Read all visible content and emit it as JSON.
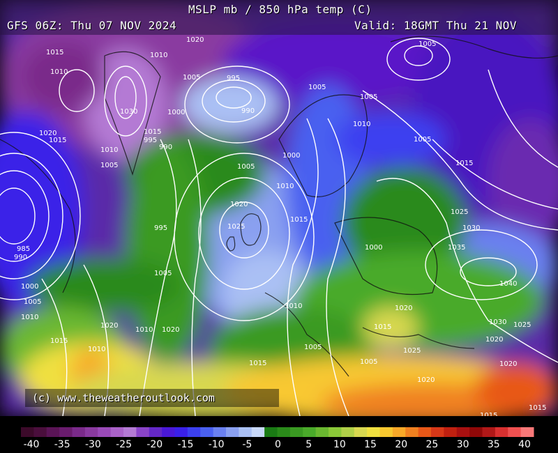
{
  "header": {
    "title": "MSLP mb / 850 hPa temp (C)",
    "run": "GFS 06Z: Thu 07 NOV 2024",
    "valid": "Valid: 18GMT Thu 21 NOV"
  },
  "credit": "(c) www.theweatheroutlook.com",
  "isobar_labels": [
    "1020",
    "1015",
    "1010",
    "1005",
    "1000",
    "995",
    "990",
    "985",
    "1025",
    "1030",
    "1035",
    "1040"
  ],
  "map_labels": [
    {
      "id": "l1",
      "text": "1015"
    },
    {
      "id": "l2",
      "text": "1010"
    },
    {
      "id": "l3",
      "text": "1010"
    },
    {
      "id": "l4",
      "text": "1005"
    },
    {
      "id": "l5",
      "text": "995"
    },
    {
      "id": "l6",
      "text": "990"
    },
    {
      "id": "l7",
      "text": "1030"
    },
    {
      "id": "l8",
      "text": "1000"
    },
    {
      "id": "l9",
      "text": "1015"
    },
    {
      "id": "l10",
      "text": "995"
    },
    {
      "id": "l11",
      "text": "990"
    },
    {
      "id": "l12",
      "text": "1005"
    },
    {
      "id": "l13",
      "text": "1005"
    },
    {
      "id": "l14",
      "text": "1000"
    },
    {
      "id": "l15",
      "text": "1005"
    },
    {
      "id": "l16",
      "text": "1010"
    },
    {
      "id": "l17",
      "text": "1020"
    },
    {
      "id": "l18",
      "text": "1025"
    },
    {
      "id": "l19",
      "text": "1015"
    },
    {
      "id": "l20",
      "text": "995"
    },
    {
      "id": "l21",
      "text": "1005"
    },
    {
      "id": "l22",
      "text": "1020"
    },
    {
      "id": "l23",
      "text": "1015"
    },
    {
      "id": "l24",
      "text": "985"
    },
    {
      "id": "l25",
      "text": "990"
    },
    {
      "id": "l26",
      "text": "1000"
    },
    {
      "id": "l27",
      "text": "1005"
    },
    {
      "id": "l28",
      "text": "1010"
    },
    {
      "id": "l29",
      "text": "1020"
    },
    {
      "id": "l30",
      "text": "1015"
    },
    {
      "id": "l31",
      "text": "1010"
    },
    {
      "id": "l32",
      "text": "1010"
    },
    {
      "id": "l33",
      "text": "1005"
    },
    {
      "id": "l34",
      "text": "1020"
    },
    {
      "id": "l35",
      "text": "1010"
    },
    {
      "id": "l36",
      "text": "1005"
    },
    {
      "id": "l37",
      "text": "1000"
    },
    {
      "id": "l38",
      "text": "1015"
    },
    {
      "id": "l39",
      "text": "1005"
    },
    {
      "id": "l40",
      "text": "1010"
    },
    {
      "id": "l41",
      "text": "1015"
    },
    {
      "id": "l42",
      "text": "1025"
    },
    {
      "id": "l43",
      "text": "1030"
    },
    {
      "id": "l44",
      "text": "1035"
    },
    {
      "id": "l45",
      "text": "1040"
    },
    {
      "id": "l46",
      "text": "1030"
    },
    {
      "id": "l47",
      "text": "1025"
    },
    {
      "id": "l48",
      "text": "1020"
    },
    {
      "id": "l49",
      "text": "1015"
    },
    {
      "id": "l50",
      "text": "1020"
    },
    {
      "id": "l51",
      "text": "1025"
    },
    {
      "id": "l52",
      "text": "1020"
    },
    {
      "id": "l53",
      "text": "1020"
    },
    {
      "id": "l54",
      "text": "1005"
    },
    {
      "id": "l55",
      "text": "1015"
    },
    {
      "id": "l56",
      "text": "1020"
    },
    {
      "id": "l57",
      "text": "1015"
    },
    {
      "id": "l58",
      "text": "1010"
    },
    {
      "id": "l59",
      "text": "1005"
    },
    {
      "id": "l60",
      "text": "1020"
    }
  ],
  "color_scale": {
    "ticks": [
      "-40",
      "-35",
      "-30",
      "-25",
      "-20",
      "-15",
      "-10",
      "-5",
      "0",
      "5",
      "10",
      "15",
      "20",
      "25",
      "30",
      "35",
      "40"
    ],
    "colors": [
      "#3c0a2a",
      "#4a0e3c",
      "#5a1456",
      "#6a1c6e",
      "#7a2a8a",
      "#8a3aa0",
      "#9a4ab8",
      "#aa62c8",
      "#b47ad4",
      "#8a44c8",
      "#6428c8",
      "#4a18d8",
      "#3a20e8",
      "#3c40f0",
      "#4a60f0",
      "#6a80f0",
      "#8aa0f0",
      "#aac0f4",
      "#c8d8f8",
      "#1a7a14",
      "#2a8a1a",
      "#3a9a22",
      "#4aaa2a",
      "#6ab830",
      "#8ac838",
      "#b0d048",
      "#d8d850",
      "#f0e040",
      "#f8c830",
      "#f8a828",
      "#f08020",
      "#e85818",
      "#d83818",
      "#c02010",
      "#a81010",
      "#900808",
      "#b01818",
      "#d83030",
      "#f05050",
      "#f87878"
    ]
  }
}
